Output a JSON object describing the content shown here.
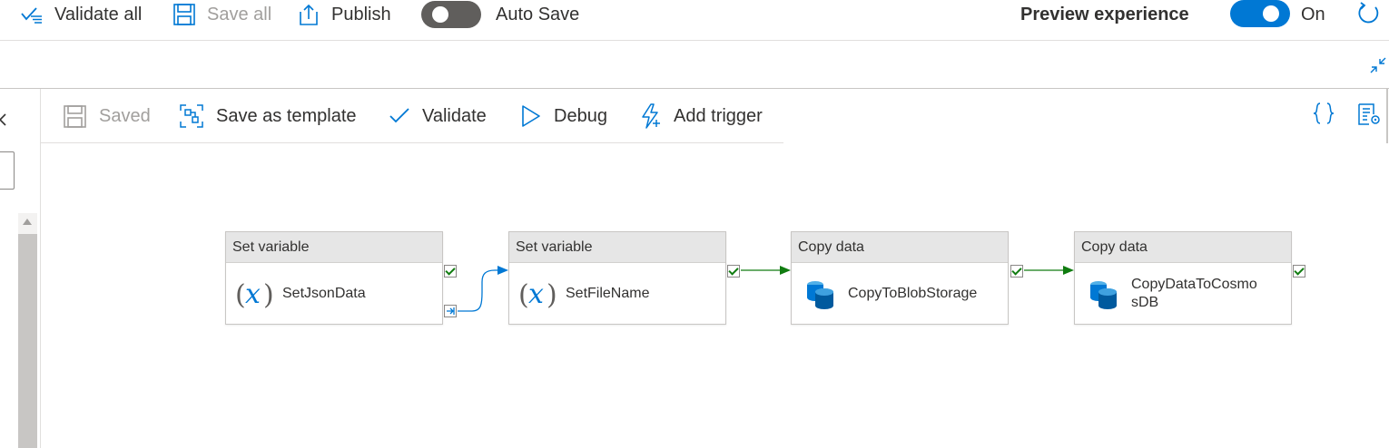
{
  "topbar": {
    "validate_all": "Validate all",
    "save_all": "Save all",
    "publish": "Publish",
    "auto_save": "Auto Save",
    "auto_save_on": false,
    "preview_experience": "Preview experience",
    "preview_state": "On",
    "preview_on": true
  },
  "pipeline_toolbar": {
    "saved": "Saved",
    "save_as_template": "Save as template",
    "validate": "Validate",
    "debug": "Debug",
    "add_trigger": "Add trigger"
  },
  "activities": [
    {
      "type": "Set variable",
      "name": "SetJsonData",
      "icon": "variable-icon"
    },
    {
      "type": "Set variable",
      "name": "SetFileName",
      "icon": "variable-icon"
    },
    {
      "type": "Copy data",
      "name": "CopyToBlobStorage",
      "icon": "database-icon"
    },
    {
      "type": "Copy data",
      "name": "CopyDataToCosmo\nsDB",
      "icon": "database-icon"
    }
  ],
  "colors": {
    "accent": "#0078d4",
    "success_green": "#107c10",
    "skip_blue": "#0078d4",
    "toggle_off": "#605e5c",
    "canvas": "#ffffff"
  }
}
